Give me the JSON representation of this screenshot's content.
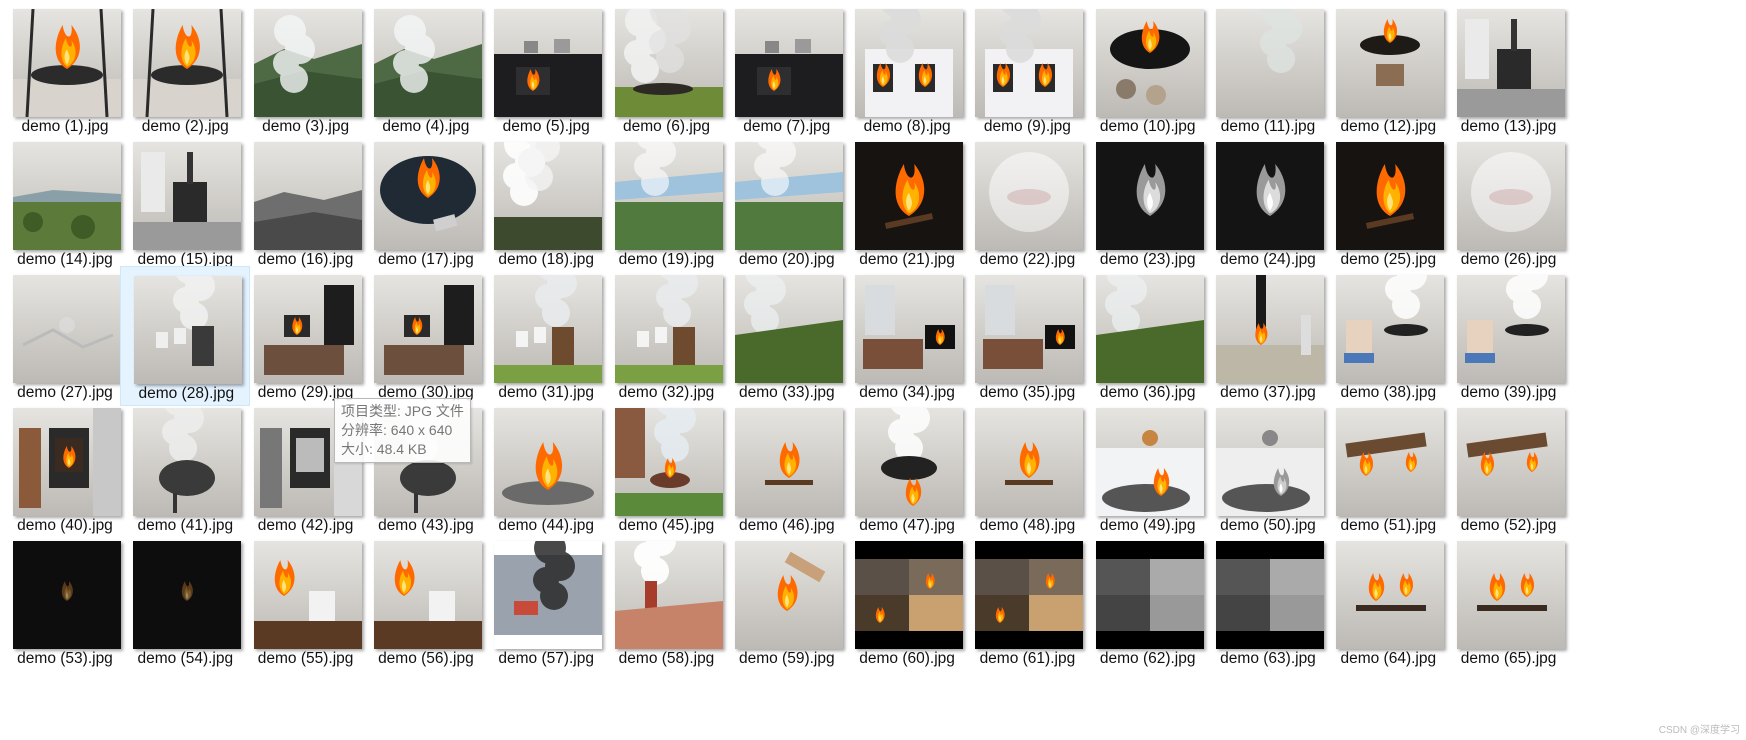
{
  "window": {
    "view": "large-icons"
  },
  "files": [
    {
      "name": "demo (1).jpg",
      "scene": "firepit-snow"
    },
    {
      "name": "demo (2).jpg",
      "scene": "firepit-snow"
    },
    {
      "name": "demo (3).jpg",
      "scene": "valley-smoke"
    },
    {
      "name": "demo (4).jpg",
      "scene": "valley-smoke"
    },
    {
      "name": "demo (5).jpg",
      "scene": "stove-kitchen"
    },
    {
      "name": "demo (6).jpg",
      "scene": "field-smoke"
    },
    {
      "name": "demo (7).jpg",
      "scene": "stove-kitchen"
    },
    {
      "name": "demo (8).jpg",
      "scene": "house-fire"
    },
    {
      "name": "demo (9).jpg",
      "scene": "house-fire"
    },
    {
      "name": "demo (10).jpg",
      "scene": "firepit-dark"
    },
    {
      "name": "demo (11).jpg",
      "scene": "forest-smoke"
    },
    {
      "name": "demo (12).jpg",
      "scene": "firepit-yard"
    },
    {
      "name": "demo (13).jpg",
      "scene": "stove-gray"
    },
    {
      "name": "demo (14).jpg",
      "scene": "landscape-sky"
    },
    {
      "name": "demo (15).jpg",
      "scene": "stove-gray"
    },
    {
      "name": "demo (16).jpg",
      "scene": "landscape-gray"
    },
    {
      "name": "demo (17).jpg",
      "scene": "firepit-blue"
    },
    {
      "name": "demo (18).jpg",
      "scene": "forest-white-smoke"
    },
    {
      "name": "demo (19).jpg",
      "scene": "aerial-blue"
    },
    {
      "name": "demo (20).jpg",
      "scene": "aerial-blue"
    },
    {
      "name": "demo (21).jpg",
      "scene": "campfire-night"
    },
    {
      "name": "demo (22).jpg",
      "scene": "fog"
    },
    {
      "name": "demo (23).jpg",
      "scene": "campfire-gray"
    },
    {
      "name": "demo (24).jpg",
      "scene": "campfire-gray"
    },
    {
      "name": "demo (25).jpg",
      "scene": "campfire-night"
    },
    {
      "name": "demo (26).jpg",
      "scene": "fog"
    },
    {
      "name": "demo (27).jpg",
      "scene": "dark-gray"
    },
    {
      "name": "demo (28).jpg",
      "scene": "barrel-gray",
      "selected": true
    },
    {
      "name": "demo (29).jpg",
      "scene": "livingroom"
    },
    {
      "name": "demo (30).jpg",
      "scene": "livingroom"
    },
    {
      "name": "demo (31).jpg",
      "scene": "barrel-green"
    },
    {
      "name": "demo (32).jpg",
      "scene": "barrel-green"
    },
    {
      "name": "demo (33).jpg",
      "scene": "hillside-smoke"
    },
    {
      "name": "demo (34).jpg",
      "scene": "livingroom-dark"
    },
    {
      "name": "demo (35).jpg",
      "scene": "livingroom-dark"
    },
    {
      "name": "demo (36).jpg",
      "scene": "hillside-smoke"
    },
    {
      "name": "demo (37).jpg",
      "scene": "factory-fire"
    },
    {
      "name": "demo (38).jpg",
      "scene": "backyard-firepit"
    },
    {
      "name": "demo (39).jpg",
      "scene": "backyard-firepit"
    },
    {
      "name": "demo (40).jpg",
      "scene": "woodstove"
    },
    {
      "name": "demo (41).jpg",
      "scene": "grill-gray"
    },
    {
      "name": "demo (42).jpg",
      "scene": "woodstove-gray"
    },
    {
      "name": "demo (43).jpg",
      "scene": "grill-gray"
    },
    {
      "name": "demo (44).jpg",
      "scene": "firepit-green"
    },
    {
      "name": "demo (45).jpg",
      "scene": "fence-smoke"
    },
    {
      "name": "demo (46).jpg",
      "scene": "campfire-forest"
    },
    {
      "name": "demo (47).jpg",
      "scene": "pot-fire"
    },
    {
      "name": "demo (48).jpg",
      "scene": "campfire-forest"
    },
    {
      "name": "demo (49).jpg",
      "scene": "dog-firepit"
    },
    {
      "name": "demo (50).jpg",
      "scene": "dog-firepit-gray"
    },
    {
      "name": "demo (51).jpg",
      "scene": "log-fire"
    },
    {
      "name": "demo (52).jpg",
      "scene": "log-fire"
    },
    {
      "name": "demo (53).jpg",
      "scene": "black"
    },
    {
      "name": "demo (54).jpg",
      "scene": "black"
    },
    {
      "name": "demo (55).jpg",
      "scene": "mug-fire"
    },
    {
      "name": "demo (56).jpg",
      "scene": "mug-fire"
    },
    {
      "name": "demo (57).jpg",
      "scene": "car-smoke"
    },
    {
      "name": "demo (58).jpg",
      "scene": "chimney"
    },
    {
      "name": "demo (59).jpg",
      "scene": "hands-fire"
    },
    {
      "name": "demo (60).jpg",
      "scene": "collage"
    },
    {
      "name": "demo (61).jpg",
      "scene": "collage"
    },
    {
      "name": "demo (62).jpg",
      "scene": "collage-gray"
    },
    {
      "name": "demo (63).jpg",
      "scene": "collage-gray"
    },
    {
      "name": "demo (64).jpg",
      "scene": "embers"
    },
    {
      "name": "demo (65).jpg",
      "scene": "embers"
    }
  ],
  "tooltip": {
    "type_line": "项目类型: JPG 文件",
    "size_line": "分辨率: 640 x 640",
    "filesize_line": "大小: 48.4 KB"
  },
  "watermark": "CSDN @深度学习"
}
